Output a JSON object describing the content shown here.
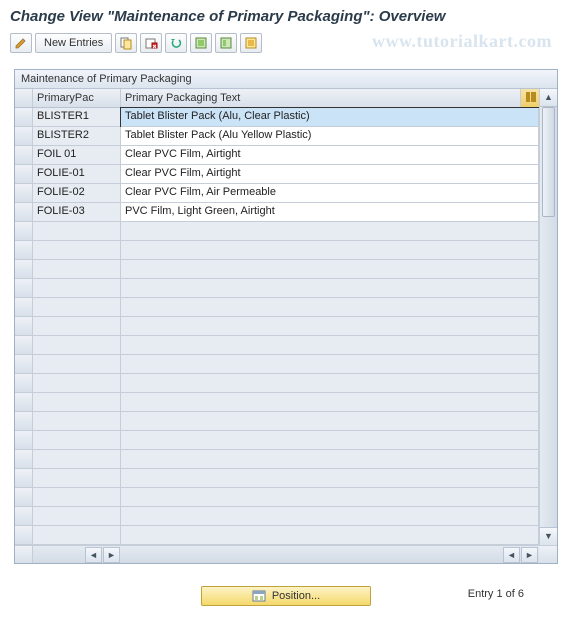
{
  "title": "Change View \"Maintenance of Primary Packaging\": Overview",
  "watermark": "www.tutorialkart.com",
  "toolbar": {
    "new_entries": "New Entries"
  },
  "panel": {
    "title": "Maintenance of Primary Packaging",
    "columns": {
      "primary_pac": "PrimaryPac",
      "primary_text": "Primary Packaging Text"
    },
    "rows": [
      {
        "pac": "BLISTER1",
        "txt": "Tablet Blister Pack (Alu, Clear Plastic)",
        "selected": true
      },
      {
        "pac": "BLISTER2",
        "txt": "Tablet Blister Pack (Alu Yellow Plastic)"
      },
      {
        "pac": "FOIL 01",
        "txt": "Clear PVC Film, Airtight"
      },
      {
        "pac": "FOLIE-01",
        "txt": "Clear PVC Film, Airtight"
      },
      {
        "pac": "FOLIE-02",
        "txt": "Clear PVC Film, Air Permeable"
      },
      {
        "pac": "FOLIE-03",
        "txt": "PVC Film, Light Green, Airtight"
      }
    ],
    "empty_row_count": 17
  },
  "footer": {
    "position_label": "Position...",
    "entry_text": "Entry 1 of 6"
  }
}
